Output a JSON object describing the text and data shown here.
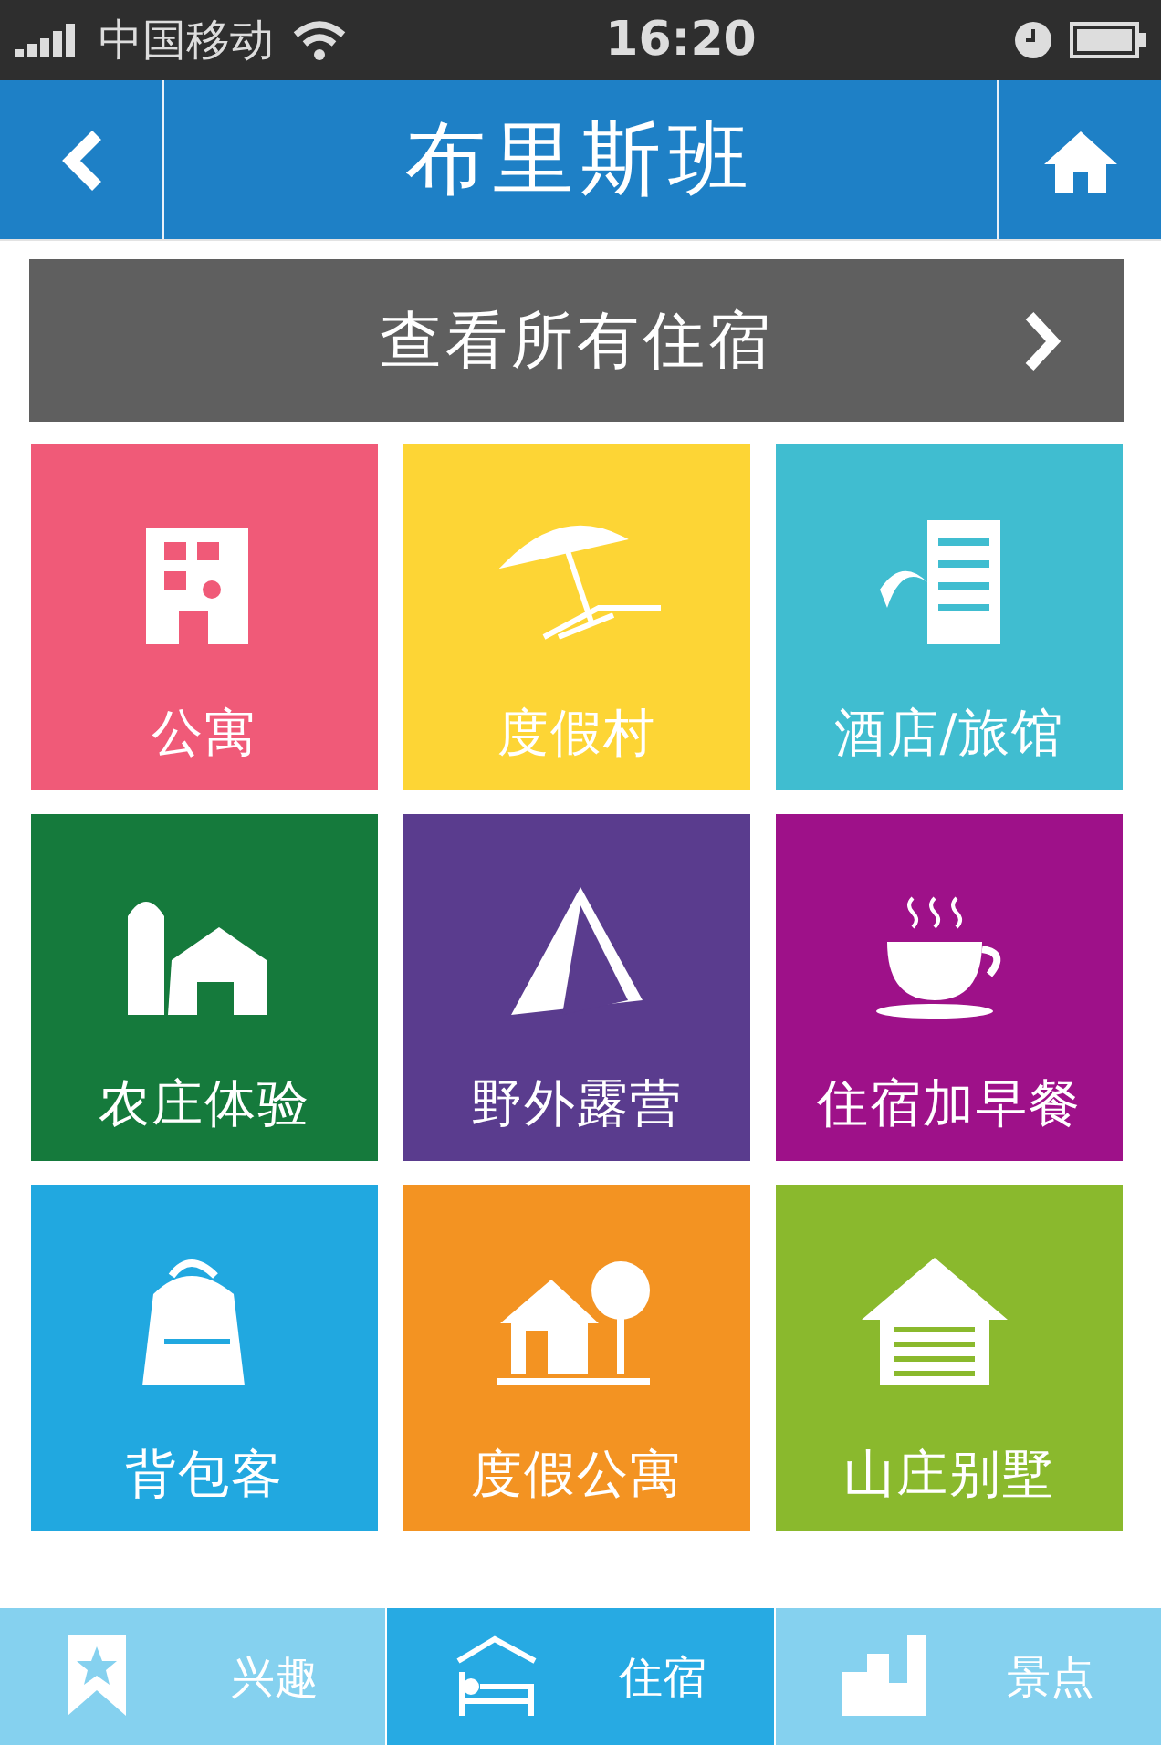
{
  "status_bar": {
    "carrier": "中国移动",
    "time": "16:20"
  },
  "nav_bar": {
    "title": "布里斯班"
  },
  "banner": {
    "label": "查看所有住宿"
  },
  "tiles": [
    {
      "label": "公寓",
      "color": "#f05a78"
    },
    {
      "label": "度假村",
      "color": "#fdd535"
    },
    {
      "label": "酒店/旅馆",
      "color": "#40bdd0"
    },
    {
      "label": "农庄体验",
      "color": "#157a3c"
    },
    {
      "label": "野外露营",
      "color": "#5a3c8e"
    },
    {
      "label": "住宿加早餐",
      "color": "#9e1189"
    },
    {
      "label": "背包客",
      "color": "#21a8e0"
    },
    {
      "label": "度假公寓",
      "color": "#f39322"
    },
    {
      "label": "山庄别墅",
      "color": "#8ab92d"
    }
  ],
  "tab_bar": [
    {
      "label": "兴趣",
      "selected": false
    },
    {
      "label": "住宿",
      "selected": true
    },
    {
      "label": "景点",
      "selected": false
    }
  ]
}
